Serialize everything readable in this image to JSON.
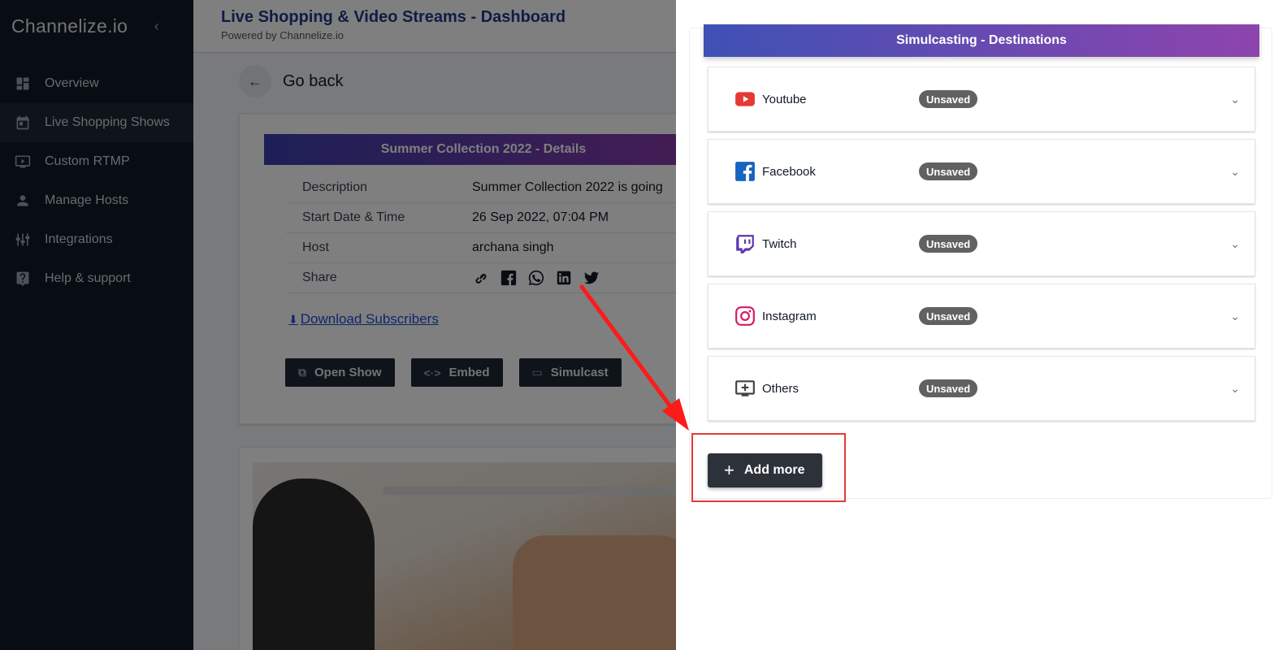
{
  "app": {
    "brand": "Channelize.io",
    "collapse_glyph": "‹"
  },
  "sidebar": {
    "items": [
      {
        "label": "Overview",
        "icon": "dashboard-icon",
        "active": false
      },
      {
        "label": "Live Shopping Shows",
        "icon": "calendar-icon",
        "active": true
      },
      {
        "label": "Custom RTMP",
        "icon": "video-icon",
        "active": false
      },
      {
        "label": "Manage Hosts",
        "icon": "person-icon",
        "active": false
      },
      {
        "label": "Integrations",
        "icon": "sliders-icon",
        "active": false
      },
      {
        "label": "Help & support",
        "icon": "help-icon",
        "active": false
      }
    ]
  },
  "header": {
    "title": "Live Shopping & Video Streams - Dashboard",
    "subtitle": "Powered by Channelize.io"
  },
  "page": {
    "go_back_label": "Go back",
    "details_title": "Summer Collection 2022 - Details",
    "details": [
      {
        "key": "Description",
        "value": "Summer Collection 2022 is going"
      },
      {
        "key": "Start Date & Time",
        "value": "26 Sep 2022, 07:04 PM"
      },
      {
        "key": "Host",
        "value": "archana singh"
      },
      {
        "key": "Share",
        "value": ""
      }
    ],
    "download_label": "Download Subscribers",
    "buttons": {
      "open_show": "Open Show",
      "embed": "Embed",
      "simulcast": "Simulcast"
    }
  },
  "drawer": {
    "title": "Simulcasting - Destinations",
    "destinations": [
      {
        "name": "Youtube",
        "status": "Unsaved",
        "icon": "youtube-icon",
        "color": "#e53935"
      },
      {
        "name": "Facebook",
        "status": "Unsaved",
        "icon": "facebook-icon",
        "color": "#1565c0"
      },
      {
        "name": "Twitch",
        "status": "Unsaved",
        "icon": "twitch-icon",
        "color": "#5e35b1"
      },
      {
        "name": "Instagram",
        "status": "Unsaved",
        "icon": "instagram-icon",
        "color": "#d81b60"
      },
      {
        "name": "Others",
        "status": "Unsaved",
        "icon": "add-to-queue-icon",
        "color": "#424242"
      }
    ],
    "add_more_label": "Add more"
  },
  "colors": {
    "sidebar_bg": "#111827",
    "header_gradient_start": "#3f51b5",
    "header_gradient_end": "#8e44ad",
    "annotation_red": "#e53935",
    "badge_grey": "#616161"
  }
}
